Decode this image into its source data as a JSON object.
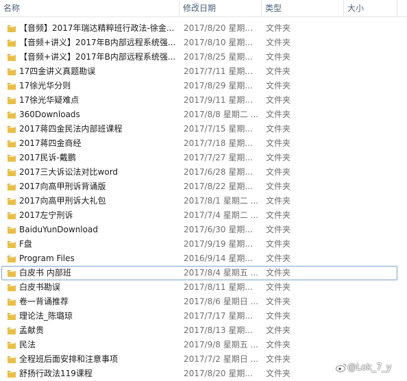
{
  "columns": {
    "name": "名称",
    "date": "修改日期",
    "type": "类型",
    "size": "大小"
  },
  "colors": {
    "folder": "#e8bf4a",
    "selection_border": "#7da2ce",
    "header_text": "#4c607a"
  },
  "rows": [
    {
      "name": "【音频】2017年瑞达精粹班行政法-徐金...",
      "date": "2017/8/20 星期...",
      "type": "文件夹",
      "icon": "folder-icon"
    },
    {
      "name": "【音频+讲义】2017年B内部远程系统强...",
      "date": "2017/8/10 星期...",
      "type": "文件夹",
      "icon": "folder-icon"
    },
    {
      "name": "【音频+讲义】2017年B内部远程系统强...",
      "date": "2017/8/25 星期...",
      "type": "文件夹",
      "icon": "folder-icon"
    },
    {
      "name": "17四金讲义真题勘误",
      "date": "2017/7/11 星期...",
      "type": "文件夹",
      "icon": "folder-icon"
    },
    {
      "name": "17徐光华分则",
      "date": "2017/8/29 星期...",
      "type": "文件夹",
      "icon": "folder-icon"
    },
    {
      "name": "17徐光华疑难点",
      "date": "2017/9/11 星期...",
      "type": "文件夹",
      "icon": "folder-icon"
    },
    {
      "name": "360Downloads",
      "date": "2017/8/8 星期二 ...",
      "type": "文件夹",
      "icon": "folder-icon"
    },
    {
      "name": "2017蒋四金民法内部班课程",
      "date": "2017/7/15 星期...",
      "type": "文件夹",
      "icon": "folder-icon"
    },
    {
      "name": "2017蒋四金商经",
      "date": "2017/7/18 星期...",
      "type": "文件夹",
      "icon": "folder-icon"
    },
    {
      "name": "2017民诉-戴鹏",
      "date": "2017/7/27 星期...",
      "type": "文件夹",
      "icon": "folder-icon"
    },
    {
      "name": "2017三大诉讼法对比word",
      "date": "2017/6/28 星期...",
      "type": "文件夹",
      "icon": "folder-icon"
    },
    {
      "name": "2017向高甲刑诉背诵版",
      "date": "2017/8/22 星期...",
      "type": "文件夹",
      "icon": "folder-icon"
    },
    {
      "name": "2017向高甲刑诉大礼包",
      "date": "2017/8/1 星期二 ...",
      "type": "文件夹",
      "icon": "folder-icon"
    },
    {
      "name": "2017左宁刑诉",
      "date": "2017/7/4 星期二 ...",
      "type": "文件夹",
      "icon": "folder-icon"
    },
    {
      "name": "BaiduYunDownload",
      "date": "2017/6/30 星期...",
      "type": "文件夹",
      "icon": "folder-icon"
    },
    {
      "name": "F盘",
      "date": "2017/9/19 星期...",
      "type": "文件夹",
      "icon": "folder-icon"
    },
    {
      "name": "Program Files",
      "date": "2016/9/14 星期...",
      "type": "文件夹",
      "icon": "folder-icon"
    },
    {
      "name": "白皮书 内部班",
      "date": "2017/8/4 星期五 ...",
      "type": "文件夹",
      "icon": "folder-icon",
      "selected": true
    },
    {
      "name": "白皮书勘误",
      "date": "2017/8/11 星期...",
      "type": "文件夹",
      "icon": "folder-icon"
    },
    {
      "name": "卷一背诵推荐",
      "date": "2017/8/6 星期日 ...",
      "type": "文件夹",
      "icon": "folder-icon"
    },
    {
      "name": "理论法_陈璐琼",
      "date": "2017/7/17 星期...",
      "type": "文件夹",
      "icon": "folder-icon"
    },
    {
      "name": "孟献贵",
      "date": "2017/8/13 星期...",
      "type": "文件夹",
      "icon": "folder-icon"
    },
    {
      "name": "民法",
      "date": "2017/9/8 星期五 ...",
      "type": "文件夹",
      "icon": "folder-icon"
    },
    {
      "name": "全程班后面安排和注意事项",
      "date": "2017/7/2 星期日 ...",
      "type": "文件夹",
      "icon": "folder-icon"
    },
    {
      "name": "舒扬行政法119课程",
      "date": "2017/8/20 星期...",
      "type": "文件夹",
      "icon": "folder-icon"
    }
  ],
  "watermark": "@Lok_7_y"
}
